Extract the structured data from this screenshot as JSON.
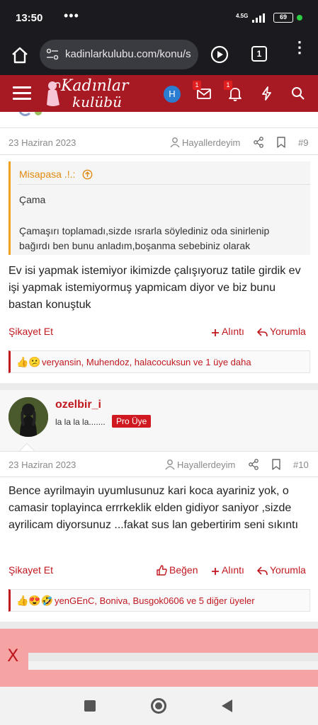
{
  "status_bar": {
    "time": "13:50",
    "dots": "•••",
    "network": "4.5G",
    "battery": "69"
  },
  "browser": {
    "url": "kadinlarkulubu.com/konu/s",
    "tab_count": "1"
  },
  "site_header": {
    "logo_line1": "Kadınlar",
    "logo_line2": "kulübü",
    "user_initial": "H",
    "messages_badge": "1",
    "alerts_badge": "1"
  },
  "post9": {
    "date": "23 Haziran 2023",
    "author": "Hayallerdeyim",
    "number": "#9",
    "quote": {
      "author": "Misapasa .!.:",
      "line1": "Çama",
      "line2": "Çamaşırı toplamadı,sizde ısrarla söylediniz oda sinirlenip bağırdı ben bunu anladım,boşanma sebebiniz olarak"
    },
    "text": "Ev isi yapmak istemiyor ikimizde çalışıyoruz tatile girdik ev işi yapmak istemiyormuş yapmicam diyor ve biz bunu bastan konuştuk",
    "actions": {
      "report": "Şikayet Et",
      "quote": "Alıntı",
      "reply": "Yorumla"
    },
    "reactions": {
      "emojis": "👍😕",
      "text": "veryansin, Muhendoz, halacocuksun ve 1 üye daha"
    }
  },
  "user10": {
    "username": "ozelbir_i",
    "user_title": "la la la la.......",
    "badge": "Pro Üye"
  },
  "post10": {
    "date": "23 Haziran 2023",
    "author": "Hayallerdeyim",
    "number": "#10",
    "text": "Bence ayrilmayin uyumlusunuz kari koca ayariniz yok, o camasir toplayinca errrkeklik elden gidiyor saniyor ,sizde ayrilicam diyorsunuz ...fakat sus lan gebertirim seni sıkıntı",
    "actions": {
      "report": "Şikayet Et",
      "like": "Beğen",
      "quote": "Alıntı",
      "reply": "Yorumla"
    },
    "reactions": {
      "emojis": "👍😍🤣",
      "text": "yenGEnC, Boniva, Busgok0606 ve 5 diğer üyeler"
    }
  },
  "ad": {
    "close": "X"
  },
  "colors": {
    "brand": "#a81a23",
    "accent_red": "#c0181f",
    "quote_orange": "#e08a10",
    "ad_pink": "#f5a3a3"
  }
}
